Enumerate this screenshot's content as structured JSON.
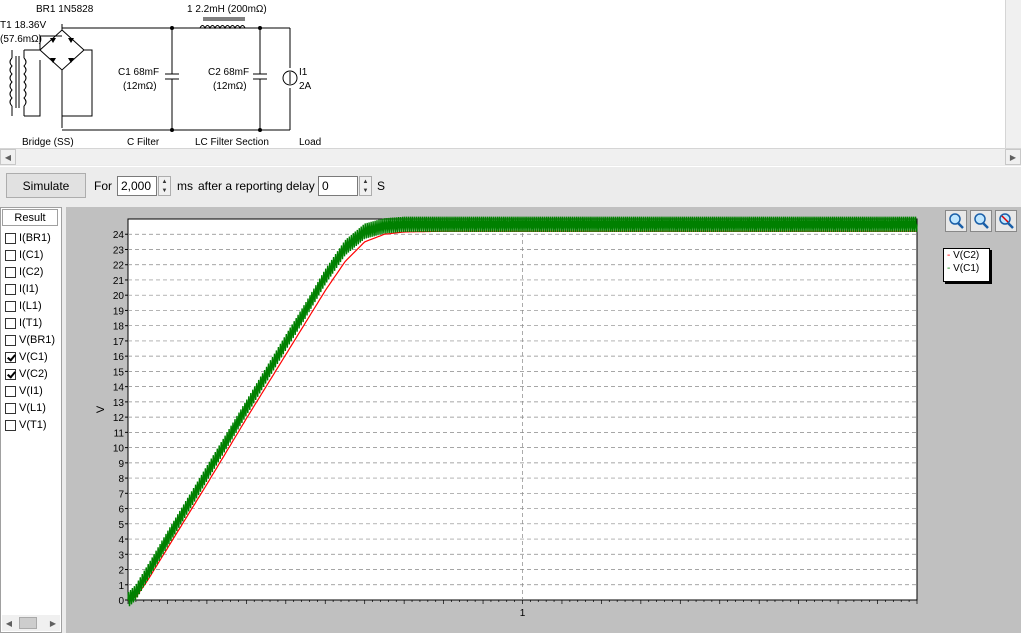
{
  "schematic": {
    "bridge_label": "BR1 1N5828",
    "transformer_label": "T1 18.36V",
    "transformer_res": "(57.6mΩ)",
    "inductor_label": "1 2.2mH (200mΩ)",
    "c1_label": "C1 68mF",
    "c1_res": "(12mΩ)",
    "c2_label": "C2 68mF",
    "c2_res": "(12mΩ)",
    "i1_label": "I1",
    "i1_value": "2A",
    "sections": [
      "Bridge (SS)",
      "C Filter",
      "LC Filter Section",
      "Load"
    ]
  },
  "toolbar": {
    "simulate_label": "Simulate",
    "for_label": "For",
    "duration_value": "2,000",
    "ms_label": "ms",
    "delay_label": "after a reporting delay of",
    "delay_value": "0",
    "s_label": "S"
  },
  "results": {
    "header": "Result",
    "items": [
      {
        "label": "I(BR1)",
        "checked": false
      },
      {
        "label": "I(C1)",
        "checked": false
      },
      {
        "label": "I(C2)",
        "checked": false
      },
      {
        "label": "I(I1)",
        "checked": false
      },
      {
        "label": "I(L1)",
        "checked": false
      },
      {
        "label": "I(T1)",
        "checked": false
      },
      {
        "label": "V(BR1)",
        "checked": false
      },
      {
        "label": "V(C1)",
        "checked": true
      },
      {
        "label": "V(C2)",
        "checked": true
      },
      {
        "label": "V(I1)",
        "checked": false
      },
      {
        "label": "V(L1)",
        "checked": false
      },
      {
        "label": "V(T1)",
        "checked": false
      }
    ]
  },
  "chart_data": {
    "type": "line",
    "ylabel": "V",
    "xlabel": "",
    "ylim": [
      0,
      25
    ],
    "xlim": [
      0,
      2
    ],
    "yticks": [
      "0",
      "1",
      "2",
      "3",
      "4",
      "5",
      "6",
      "7",
      "8",
      "9",
      "10",
      "11",
      "12",
      "13",
      "14",
      "15",
      "16",
      "17",
      "18",
      "19",
      "20",
      "21",
      "22",
      "23",
      "24"
    ],
    "xticks": [
      "1"
    ],
    "grid": true,
    "legend_position": "right",
    "series": [
      {
        "name": "V(C2)",
        "color": "#ff0000",
        "x": [
          0,
          0.02,
          0.05,
          0.1,
          0.2,
          0.3,
          0.4,
          0.45,
          0.5,
          0.55,
          0.6,
          0.65,
          0.7,
          0.8,
          1.0,
          1.5,
          2.0
        ],
        "y": [
          0,
          0.2,
          1.3,
          3.4,
          7.6,
          11.9,
          16.1,
          18.2,
          20.3,
          22.2,
          23.5,
          24.0,
          24.15,
          24.2,
          24.2,
          24.2,
          24.2
        ]
      },
      {
        "name": "V(C1)",
        "color": "#008000",
        "ripple": 0.5,
        "x": [
          0,
          0.02,
          0.05,
          0.1,
          0.2,
          0.3,
          0.4,
          0.45,
          0.5,
          0.55,
          0.6,
          0.65,
          0.7,
          0.8,
          1.0,
          1.5,
          2.0
        ],
        "y": [
          0,
          0.5,
          1.8,
          4.0,
          8.3,
          12.6,
          16.9,
          19.0,
          21.2,
          23.1,
          24.2,
          24.55,
          24.65,
          24.65,
          24.65,
          24.65,
          24.65
        ]
      }
    ]
  },
  "colors": {
    "v_c2": "#ff0000",
    "v_c1": "#008000",
    "background": "#c0c0c0",
    "plot_bg": "#ffffff"
  },
  "zoom_icons": [
    "zoom-in-icon",
    "zoom-fit-icon",
    "zoom-out-icon"
  ]
}
